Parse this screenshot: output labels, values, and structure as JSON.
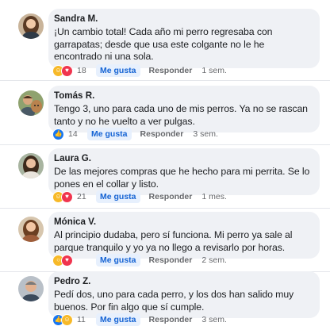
{
  "comments": [
    {
      "name": "Sandra M.",
      "text": "¡Un cambio total! Cada año mi perro regresaba con garrapatas; desde que usa este colgante no le he encontrado ni una sola.",
      "reactions": [
        "haha",
        "love"
      ],
      "count": "18",
      "like_label": "Me gusta",
      "reply_label": "Responder",
      "time": "1 sem."
    },
    {
      "name": "Tomás R.",
      "text": "Tengo 3, uno para cada uno de mis perros. Ya no se rascan tanto y no he vuelto a ver pulgas.",
      "reactions": [
        "like"
      ],
      "count": "14",
      "like_label": "Me gusta",
      "reply_label": "Responder",
      "time": "3 sem."
    },
    {
      "name": "Laura G.",
      "text": "De las mejores compras que he hecho para mi perrita. Se lo pones en el collar y listo.",
      "reactions": [
        "haha",
        "love"
      ],
      "count": "21",
      "like_label": "Me gusta",
      "reply_label": "Responder",
      "time": "1 mes."
    },
    {
      "name": "Mónica V.",
      "text": "Al principio dudaba, pero sí funciona. Mi perro ya sale al parque tranquilo y yo ya no llego a revisarlo por horas.",
      "reactions": [
        "wow",
        "love"
      ],
      "count": "",
      "like_label": "Me gusta",
      "reply_label": "Responder",
      "time": "2 sem."
    },
    {
      "name": "Pedro Z.",
      "text": "Pedí dos, uno para cada perro, y los dos han salido muy buenos. Por fin algo que sí cumple.",
      "reactions": [
        "like",
        "haha"
      ],
      "count": "11",
      "like_label": "Me gusta",
      "reply_label": "Responder",
      "time": "3 sem."
    }
  ],
  "colors": {
    "bubble": "#eff1f5",
    "like_button_bg": "#e7f0fd",
    "like_button_text": "#1664d4",
    "meta_text": "#65676b"
  },
  "icons": {
    "haha": "haha-reaction-icon",
    "love": "love-reaction-icon",
    "wow": "wow-reaction-icon",
    "like": "like-reaction-icon"
  }
}
